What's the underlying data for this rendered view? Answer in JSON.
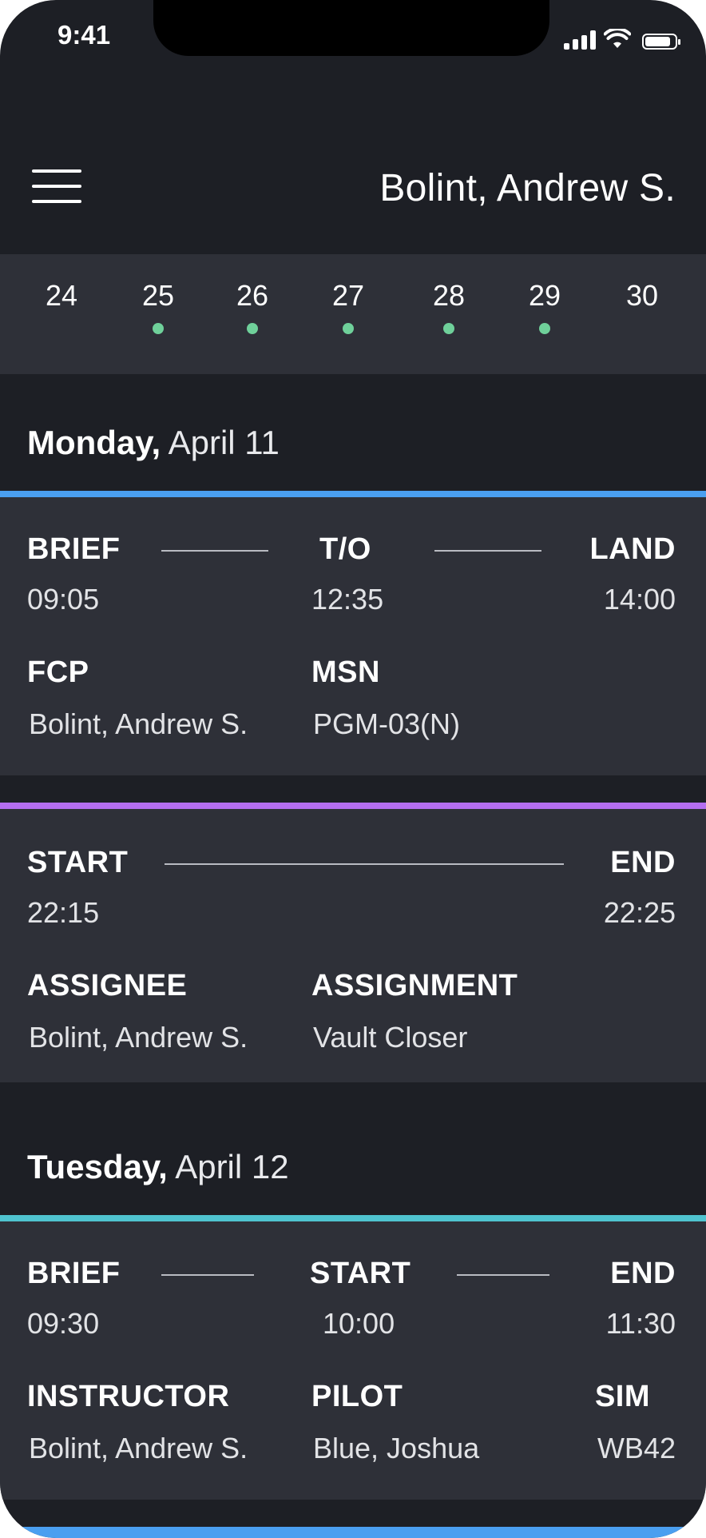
{
  "status_bar": {
    "time": "9:41",
    "battery_level": 0.85
  },
  "header": {
    "user_name": "Bolint, Andrew S."
  },
  "date_strip": [
    {
      "day": "24",
      "has_event": false
    },
    {
      "day": "25",
      "has_event": true
    },
    {
      "day": "26",
      "has_event": true
    },
    {
      "day": "27",
      "has_event": true
    },
    {
      "day": "28",
      "has_event": true
    },
    {
      "day": "29",
      "has_event": true
    },
    {
      "day": "30",
      "has_event": false
    }
  ],
  "colors": {
    "background": "#1d1f25",
    "card": "#2e3038",
    "event_dot": "#6fd09a",
    "flight_bar": "#4a9ff0",
    "duty_bar": "#b56ef0",
    "sim_bar": "#4fc3cf"
  },
  "days": [
    {
      "weekday": "Monday,",
      "date": "April 11",
      "events": [
        {
          "type": "flight",
          "labels": [
            "BRIEF",
            "T/O",
            "LAND"
          ],
          "times": [
            "09:05",
            "12:35",
            "14:00"
          ],
          "detail_labels": [
            "FCP",
            "MSN"
          ],
          "detail_values": [
            "Bolint, Andrew S.",
            "PGM-03(N)"
          ]
        },
        {
          "type": "duty",
          "labels": [
            "START",
            "END"
          ],
          "times": [
            "22:15",
            "22:25"
          ],
          "detail_labels": [
            "ASSIGNEE",
            "ASSIGNMENT"
          ],
          "detail_values": [
            "Bolint, Andrew S.",
            "Vault Closer"
          ]
        }
      ]
    },
    {
      "weekday": "Tuesday,",
      "date": "April 12",
      "events": [
        {
          "type": "sim",
          "labels": [
            "BRIEF",
            "START",
            "END"
          ],
          "times": [
            "09:30",
            "10:00",
            "11:30"
          ],
          "detail_labels": [
            "INSTRUCTOR",
            "PILOT",
            "SIM"
          ],
          "detail_values": [
            "Bolint, Andrew S.",
            "Blue, Joshua",
            "WB42"
          ]
        }
      ]
    }
  ]
}
